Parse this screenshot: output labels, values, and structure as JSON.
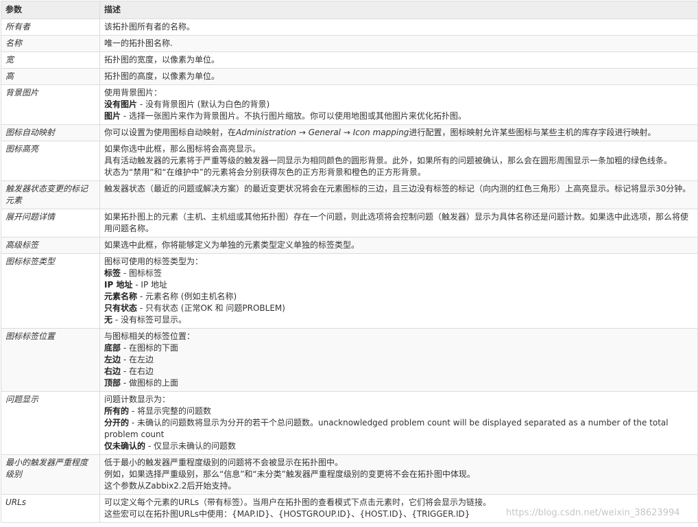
{
  "table": {
    "headers": {
      "param": "参数",
      "desc": "描述"
    },
    "rows": [
      {
        "name": "所有者",
        "lines": [
          {
            "text": "该拓扑图所有者的名称。"
          }
        ]
      },
      {
        "name": "名称",
        "lines": [
          {
            "text": "唯一的拓扑图名称."
          }
        ]
      },
      {
        "name": "宽",
        "lines": [
          {
            "text": "拓扑图的宽度，以像素为单位。"
          }
        ]
      },
      {
        "name": "高",
        "lines": [
          {
            "text": "拓扑图的高度，以像素为单位。"
          }
        ]
      },
      {
        "name": "背景图片",
        "lines": [
          {
            "text": "使用背景图片："
          },
          {
            "term": "没有图片",
            "text": " - 没有背景图片 (默认为白色的背景)"
          },
          {
            "term": "图片",
            "text": " - 选择一张图片来作为背景图片。不执行图片缩放。你可以使用地图或其他图片来优化拓扑图。"
          }
        ]
      },
      {
        "name": "图标自动映射",
        "lines": [
          {
            "pre": "你可以设置为使用图标自动映射，在",
            "em": "Administration → General → Icon mapping",
            "text": "进行配置，图标映射允许某些图标与某些主机的库存字段进行映射。"
          }
        ]
      },
      {
        "name": "图标高亮",
        "lines": [
          {
            "text": "如果你选中此框，那么图标将会高亮显示。"
          },
          {
            "text": "具有活动触发器的元素将于严重等级的触发器一同显示为相同颜色的圆形背景。此外，如果所有的问题被确认，那么会在圆形周围显示一条加粗的绿色线条。"
          },
          {
            "text": "状态为“禁用”和“在维护中”的元素将会分别获得灰色的正方形背景和橙色的正方形背景。"
          }
        ]
      },
      {
        "name": "触发器状态变更的标记元素",
        "lines": [
          {
            "text": "触发器状态（最近的问题或解决方案）的最近变更状况将会在元素图标的三边，且三边没有标签的标记（向内测的红色三角形）上高亮显示。标记将显示30分钟。"
          }
        ]
      },
      {
        "name": "展开问题详情",
        "lines": [
          {
            "text": "如果拓扑图上的元素（主机、主机组或其他拓扑图）存在一个问题，则此选项将会控制问题（触发器）显示为具体名称还是问题计数。如果选中此选项，那么将使用问题名称。"
          }
        ]
      },
      {
        "name": "高级标签",
        "lines": [
          {
            "text": "如果选中此框，你将能够定义为单独的元素类型定义单独的标签类型。"
          }
        ]
      },
      {
        "name": "图标标签类型",
        "lines": [
          {
            "text": "图标可使用的标签类型为："
          },
          {
            "term": "标签",
            "text": " - 图标标签"
          },
          {
            "term": "IP 地址",
            "text": " - IP 地址"
          },
          {
            "term": "元素名称",
            "text": " - 元素名称 (例如主机名称)"
          },
          {
            "term": "只有状态",
            "text": " - 只有状态 (正常OK 和 问题PROBLEM)"
          },
          {
            "term": "无",
            "text": " - 没有标签可显示。"
          }
        ]
      },
      {
        "name": "图标标签位置",
        "lines": [
          {
            "text": "与图标相关的标签位置："
          },
          {
            "term": "底部",
            "text": " - 在图标的下面"
          },
          {
            "term": "左边",
            "text": " - 在左边"
          },
          {
            "term": "右边",
            "text": " - 在右边"
          },
          {
            "term": "顶部",
            "text": " - 做图标的上面"
          }
        ]
      },
      {
        "name": "问题显示",
        "lines": [
          {
            "text": "问题计数显示为："
          },
          {
            "term": "所有的",
            "text": " - 将显示完整的问题数"
          },
          {
            "term": "分开的",
            "text": " - 未确认的问题数将显示为分开的若干个总问题数。unacknowledged problem count will be displayed separated as a number of the total problem count"
          },
          {
            "term": "仅未确认的",
            "text": " - 仅显示未确认的问题数"
          }
        ]
      },
      {
        "name": "最小的触发器严重程度级别",
        "lines": [
          {
            "text": "低于最小的触发器严重程度级别的问题将不会被显示在拓扑图中。"
          },
          {
            "text": "例如，如果选择严重级别，那么“信息”和“未分类”触发器严重程度级别的变更将不会在拓扑图中体现。"
          },
          {
            "text": "这个参数从Zabbix2.2后开始支持。"
          }
        ]
      },
      {
        "name": "URLs",
        "lines": [
          {
            "text": "可以定义每个元素的URLs（带有标签）。当用户在拓扑图的查看模式下点击元素时，它们将会显示为链接。"
          },
          {
            "text": "这些宏可以在拓扑图URLs中使用：{MAP.ID}、{HOSTGROUP.ID}、{HOST.ID}、{TRIGGER.ID}"
          }
        ]
      }
    ]
  },
  "watermark": "https://blog.csdn.net/weixin_38623994"
}
